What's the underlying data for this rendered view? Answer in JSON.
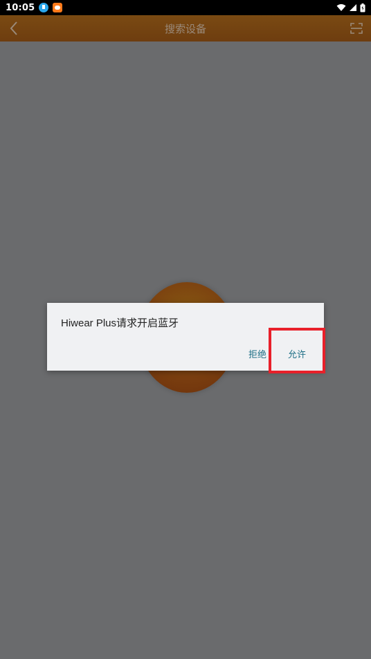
{
  "status_bar": {
    "time": "10:05",
    "icons": [
      "download-icon",
      "app-notification-icon",
      "wifi-icon",
      "signal-icon",
      "battery-icon"
    ]
  },
  "app_bar": {
    "title": "搜索设备",
    "left_icon": "chevron-left-icon",
    "right_icon": "scan-icon"
  },
  "dialog": {
    "message": "Hiwear Plus请求开启蓝牙",
    "deny_label": "拒绝",
    "allow_label": "允许"
  },
  "colors": {
    "overlay": "#6a6b6d",
    "dialog_bg": "#f0f1f3",
    "button_text": "#1e6f86",
    "highlight": "#e8202a",
    "app_bar": "#7a4a12"
  }
}
